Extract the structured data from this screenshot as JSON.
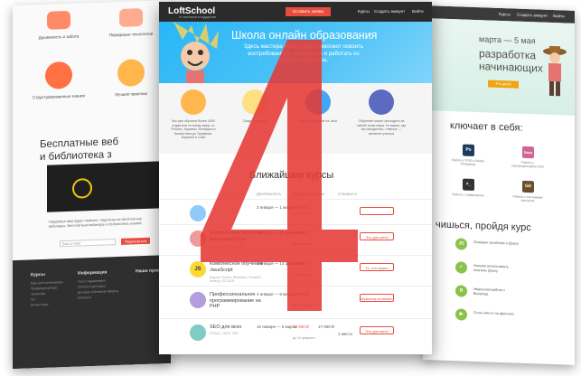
{
  "left_page": {
    "features": [
      {
        "label": "Душевность и забота"
      },
      {
        "label": "Передовые технологии"
      },
      {
        "label": "Структурированные знания"
      },
      {
        "label": "Лучшие практики"
      }
    ],
    "title_line1": "Бесплатные веб",
    "title_line2": "и библиотека з",
    "form_text": "Надеемся вам будет полезно: подписка на бесплатные вебинары. Бесплатные вебинары и библиотека знаний.",
    "input_placeholder": "Ваш e-mail",
    "subscribe_label": "Подписаться",
    "footer": {
      "col1_title": "Курсы",
      "col1_items": [
        "Курс для начинающих",
        "Продвинутый курс",
        "Javascript",
        "Git",
        "Бизнес-курс"
      ],
      "col2_title": "Информация",
      "col2_items": [
        "Часто задаваемые",
        "Оплата и доставка",
        "Договор публичной оферты",
        "Контакты"
      ],
      "col3_title": "Наши проект"
    }
  },
  "center_page": {
    "logo": "LoftSchool",
    "logo_sub": "от мастеров в поддержке",
    "nav_button": "Оставить заявку",
    "nav_links": [
      "Курсы",
      "Создать аккаунт",
      "Войти"
    ],
    "hero_title": "Школа онлайн образования",
    "hero_lead": "Здесь мастера своего дела помогают освоить востребованную профессию и работать из любой точки мира.",
    "features": [
      "Мы уже обучили более 1000 студентов по всему миру: от России, Украины, Беларуси и Казахстана до Германии, Израиля и США",
      "Средн на рынок",
      "Вы мо студентов на Java",
      "Обучение может проходить из любой точки мира: не важно, где вы находитесь, главное — желание учиться"
    ],
    "section_title": "Ближайшие курсы",
    "table_headers": [
      "Длительность",
      "Предварительная",
      "Стоимость"
    ],
    "rows": [
      {
        "icon": "",
        "name": "",
        "tags": "",
        "date": "3 января — 1 марта",
        "price": "19 000 ₽",
        "note": "до 1 февраля",
        "price2": "",
        "status": ""
      },
      {
        "icon": "",
        "name": "Комплексное обучение веб-разработке",
        "tags": "HTML5, CSS3, JQUERY",
        "date": "2 января — 20 февраля",
        "price": "19 000 ₽",
        "note": "до февраля",
        "price2": "",
        "status": "",
        "button": "Это для меня"
      },
      {
        "icon": "JS",
        "name": "Комплексное обучение JavaScript",
        "tags": "Angular, Ember, Backbone, ReactJS, Node.js, ES 2015",
        "date": "2 января — 14 февраля",
        "price": "19 000 ₽",
        "note": "до февраля",
        "price2": "",
        "status": "",
        "button": "То, что нужно"
      },
      {
        "icon": "",
        "name": "Профессиональное программирование на PHP",
        "tags": "",
        "date": "4 января — 8 марта",
        "price": "17 000 ₽",
        "note": "до 6 февраля",
        "price2": "",
        "status": "",
        "button": "Мужчина понимает"
      },
      {
        "icon": "",
        "name": "SEO для всех",
        "tags": "HTML5, CSS3, SEO",
        "date": "10 января — 8 марта",
        "price": "13 000 ₽",
        "note": "до 10 февраля",
        "price2": "17 000 ₽",
        "status": "1 место",
        "button": "Это для меня"
      }
    ]
  },
  "right_page": {
    "nav_links": [
      "Курсы",
      "Создать аккаунт",
      "Войти"
    ],
    "hero_date": "марта — 5 мая",
    "hero_title_line1": "разработка",
    "hero_title_line2": "начинающих",
    "hero_button": "Я в деле!",
    "include_title": "ключает в себя:",
    "tools": [
      {
        "icon": "Ps",
        "caption": "Работа с PSD в Adobe Photoshop",
        "color": "#1e3a5f"
      },
      {
        "icon": "Sass",
        "caption": "Работа с препроцессором CSS",
        "color": "#cf649a"
      },
      {
        "icon": ">_",
        "caption": "Работа с терминалом",
        "color": "#333333"
      },
      {
        "icon": "Git",
        "caption": "Работа с системами контроля",
        "color": "#6b4f2a"
      }
    ],
    "learn_title": "чишься, пройдя курс",
    "learn_items": [
      {
        "icon": "JS",
        "text": "Основам JavaScript и jQuery",
        "color": "#8bc34a"
      },
      {
        "icon": "✓",
        "text": "Умению использовать плагины jQuery",
        "color": "#8bc34a"
      },
      {
        "icon": "B",
        "text": "Уверенная работа с Bootstrap",
        "color": "#8bc34a"
      },
      {
        "icon": "▶",
        "text": "Стать кем-то на фриланс",
        "color": "#8bc34a"
      }
    ]
  },
  "overlay": {
    "number": "4",
    "color": "#e53935"
  }
}
